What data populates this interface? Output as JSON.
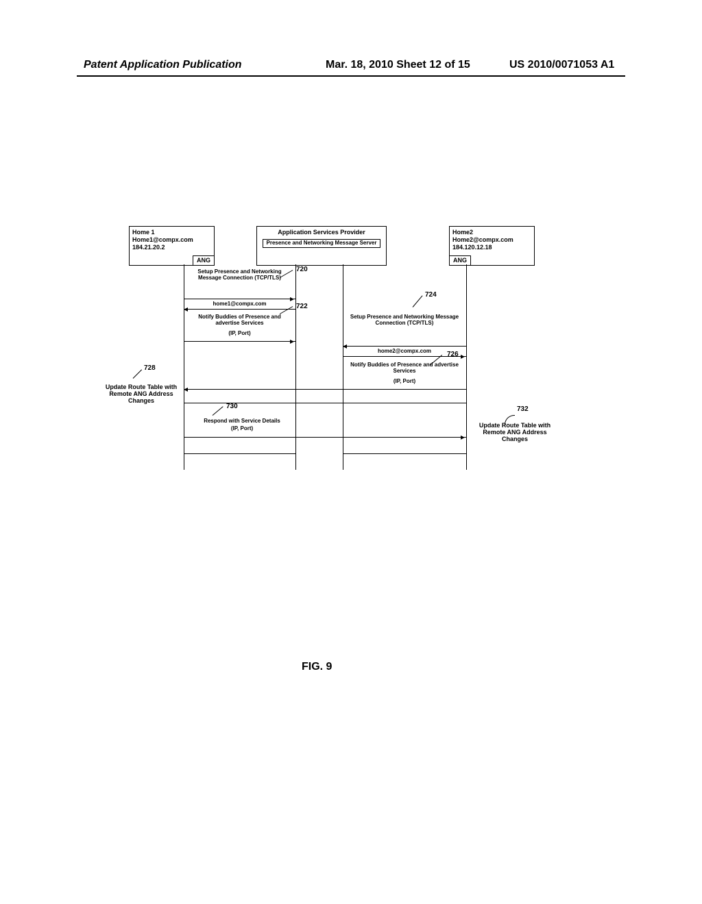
{
  "header": {
    "left": "Patent Application Publication",
    "mid": "Mar. 18, 2010   Sheet 12 of 15",
    "right": "US 2010/0071053 A1"
  },
  "figure_caption": "FIG. 9",
  "actors": {
    "home1": {
      "title": "Home 1",
      "addr": "Home1@compx.com",
      "ip": "184.21.20.2",
      "sub": "ANG"
    },
    "provider": {
      "title": "Application Services Provider",
      "sub": "Presence and Networking Message Server"
    },
    "home2": {
      "title": "Home2",
      "addr": "Home2@compx.com",
      "ip": "184.120.12.18",
      "sub": "ANG"
    }
  },
  "messages": {
    "m720": "Setup Presence and Networking Message Connection (TCP/TLS)",
    "m722_a": "home1@compx.com",
    "m722_b": "Notify Buddies of Presence and advertise Services",
    "m722_c": "(IP, Port)",
    "m724": "Setup Presence and Networking Message Connection (TCP/TLS)",
    "m726_a": "home2@compx.com",
    "m726_b": "Notify Buddies of Presence and advertise Services",
    "m726_c": "(IP, Port)",
    "m730_a": "Respond with Service Details",
    "m730_b": "(IP, Port)"
  },
  "refs": {
    "r720": "720",
    "r722": "722",
    "r724": "724",
    "r726": "726",
    "r728": "728",
    "r730": "730",
    "r732": "732"
  },
  "side": {
    "s728": "Update Route Table with Remote ANG Address Changes",
    "s732": "Update Route Table with Remote ANG Address Changes"
  }
}
